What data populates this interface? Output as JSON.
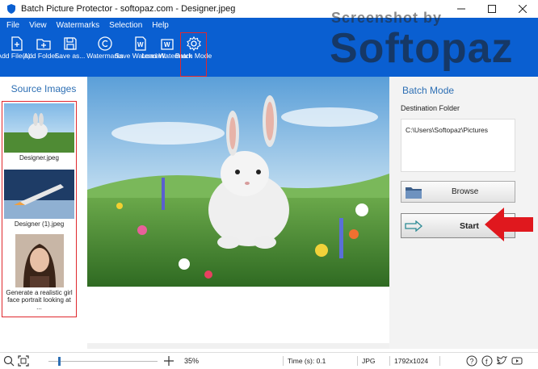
{
  "window": {
    "title": "Batch Picture Protector - softopaz.com - Designer.jpeg",
    "controls": [
      "minimize-icon",
      "maximize-icon",
      "close-icon"
    ]
  },
  "menu": {
    "items": [
      "File",
      "View",
      "Watermarks",
      "Selection",
      "Help"
    ]
  },
  "toolbar": {
    "add_files": "Add File(s)...",
    "add_folder": "Add Folder...",
    "save_as": "Save as...",
    "watermarks": "Watermarks",
    "save_watermark": "Save Watermark",
    "load_watermark": "Load Watermark",
    "batch_mode": "Batch Mode"
  },
  "source_images": {
    "header": "Source Images",
    "items": [
      {
        "caption": "Designer.jpeg"
      },
      {
        "caption": "Designer (1).jpeg"
      },
      {
        "caption": "Generate a realistic girl face portrait looking at ..."
      }
    ]
  },
  "batch_mode": {
    "header": "Batch Mode",
    "destination_label": "Destination Folder",
    "destination_path": "C:\\Users\\Softopaz\\Pictures",
    "browse_label": "Browse",
    "start_label": "Start"
  },
  "statusbar": {
    "zoom_percent": "35%",
    "zoom_level": 0.35,
    "time_label": "Time (s): 0.1",
    "format": "JPG",
    "dimensions": "1792x1024"
  },
  "watermark_overlay": {
    "subtitle": "Screenshot by",
    "brand": "Softopaz"
  },
  "colors": {
    "accent": "#0a5fd1",
    "highlight": "#e0282e",
    "panel_header": "#2d6fb4"
  }
}
